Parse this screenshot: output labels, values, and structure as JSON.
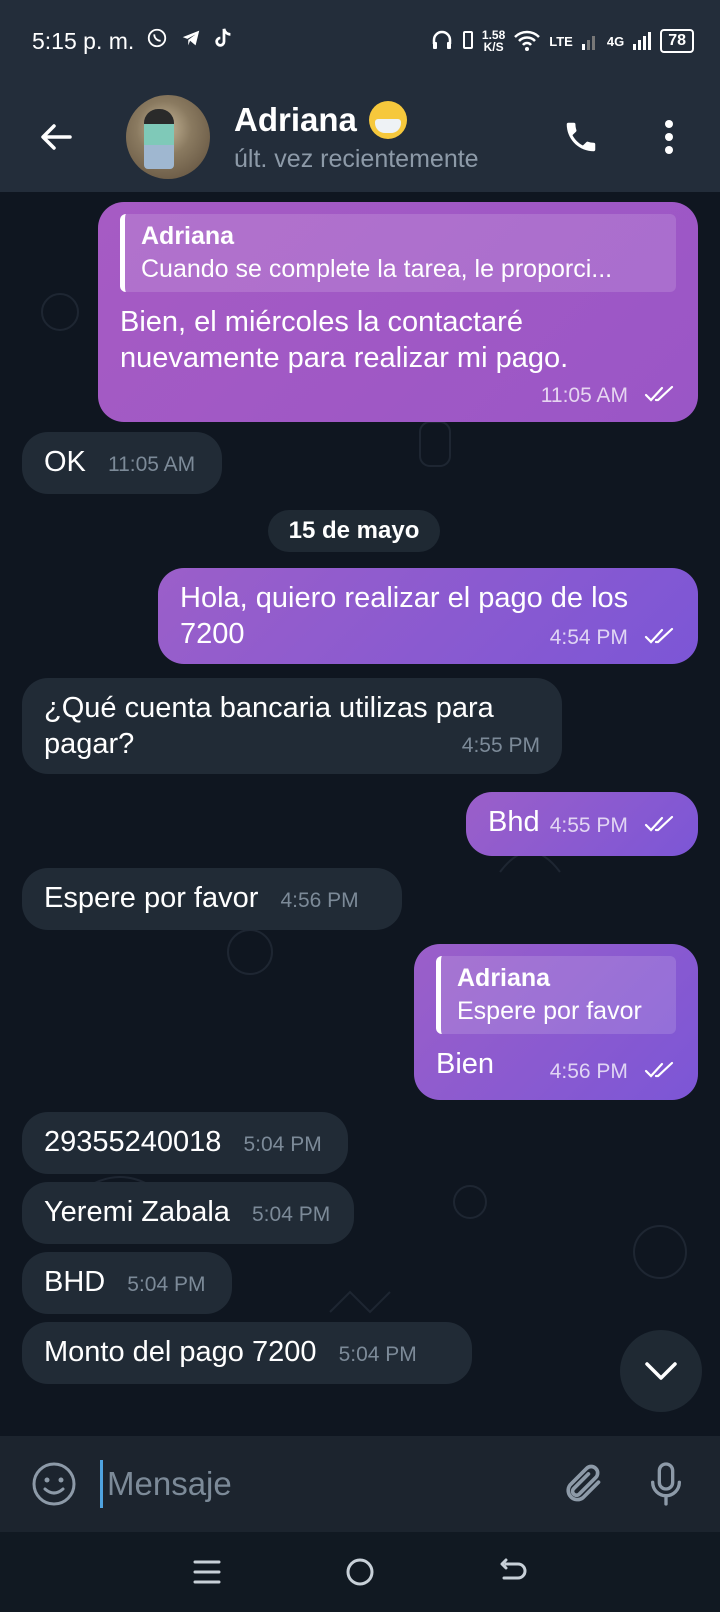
{
  "status_bar": {
    "time": "5:15 p. m.",
    "speed_value": "1.58",
    "speed_unit": "K/S",
    "lte_label": "LTE",
    "network_label": "4G",
    "battery": "78"
  },
  "header": {
    "contact_name": "Adriana",
    "last_seen": "últ. vez recientemente"
  },
  "chat": {
    "messages": [
      {
        "direction": "out",
        "reply_name": "Adriana",
        "reply_text": "Cuando se complete la tarea, le proporci...",
        "text_line1": "Bien, el miércoles la contactaré",
        "text_line2": "nuevamente para realizar mi pago.",
        "time": "11:05 AM"
      },
      {
        "direction": "in",
        "text": "OK",
        "time": "11:05 AM"
      },
      {
        "direction": "out",
        "text_line1": "Hola, quiero realizar el pago de los",
        "text_line2": "7200",
        "time": "4:54 PM"
      },
      {
        "direction": "in",
        "text_line1": "¿Qué cuenta bancaria utilizas para",
        "text_line2": "pagar?",
        "time": "4:55 PM"
      },
      {
        "direction": "out",
        "text": "Bhd",
        "time": "4:55 PM"
      },
      {
        "direction": "in",
        "text": "Espere por favor",
        "time": "4:56 PM"
      },
      {
        "direction": "out",
        "reply_name": "Adriana",
        "reply_text": "Espere por favor",
        "text": "Bien",
        "time": "4:56 PM"
      },
      {
        "direction": "in",
        "text": "29355240018",
        "time": "5:04 PM"
      },
      {
        "direction": "in",
        "text": "Yeremi Zabala",
        "time": "5:04 PM"
      },
      {
        "direction": "in",
        "text": "BHD",
        "time": "5:04 PM"
      },
      {
        "direction": "in",
        "text": "Monto del pago 7200",
        "time": "5:04 PM"
      }
    ],
    "date_separator": "15 de mayo"
  },
  "input": {
    "placeholder": "Mensaje"
  },
  "icons": {
    "back": "arrow-left-icon",
    "phone": "phone-icon",
    "menu": "more-vertical-icon",
    "emoji": "smiley-icon",
    "attach": "paperclip-icon",
    "mic": "microphone-icon",
    "scroll_down": "chevron-down-icon"
  },
  "colors": {
    "outgoing_bubble": "#8a58d0",
    "incoming_bubble": "#212b36",
    "header_bg": "#232d3a",
    "chat_bg": "#0f1620"
  }
}
